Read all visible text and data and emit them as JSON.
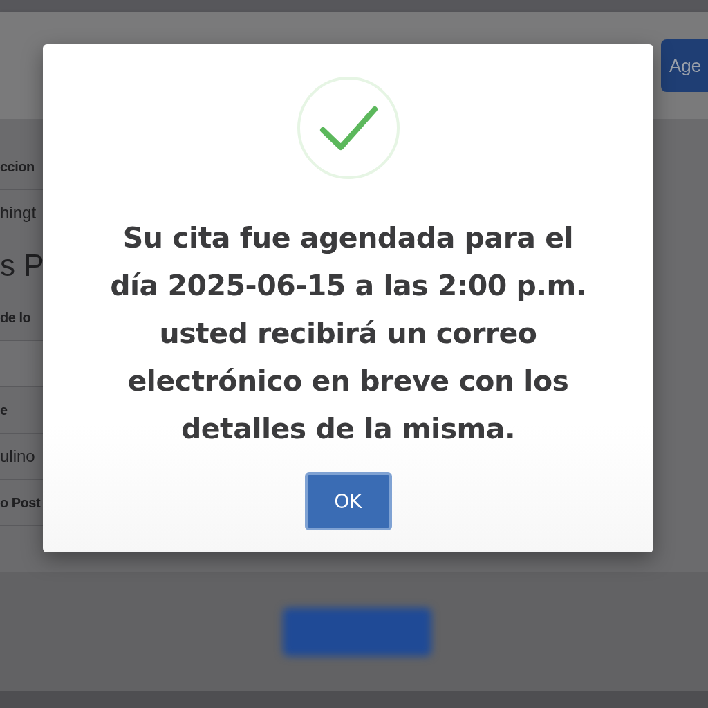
{
  "header": {
    "button": "Age"
  },
  "background_rows": [
    {
      "kind": "label",
      "text": "ccion"
    },
    {
      "kind": "value",
      "text": "hingt"
    },
    {
      "kind": "heading",
      "text": "s P"
    },
    {
      "kind": "label",
      "text": "de lo"
    },
    {
      "kind": "blank",
      "text": ""
    },
    {
      "kind": "label",
      "text": "e"
    },
    {
      "kind": "value",
      "text": "ulino"
    },
    {
      "kind": "label",
      "text": "o Post"
    }
  ],
  "dialog": {
    "message": "Su cita fue agendada para el\ndía 2025-06-15 a las 2:00 p.m.\nusted recibirá un correo\nelectrónico en breve con los\ndetalles de la misma.",
    "ok_button": "OK"
  }
}
